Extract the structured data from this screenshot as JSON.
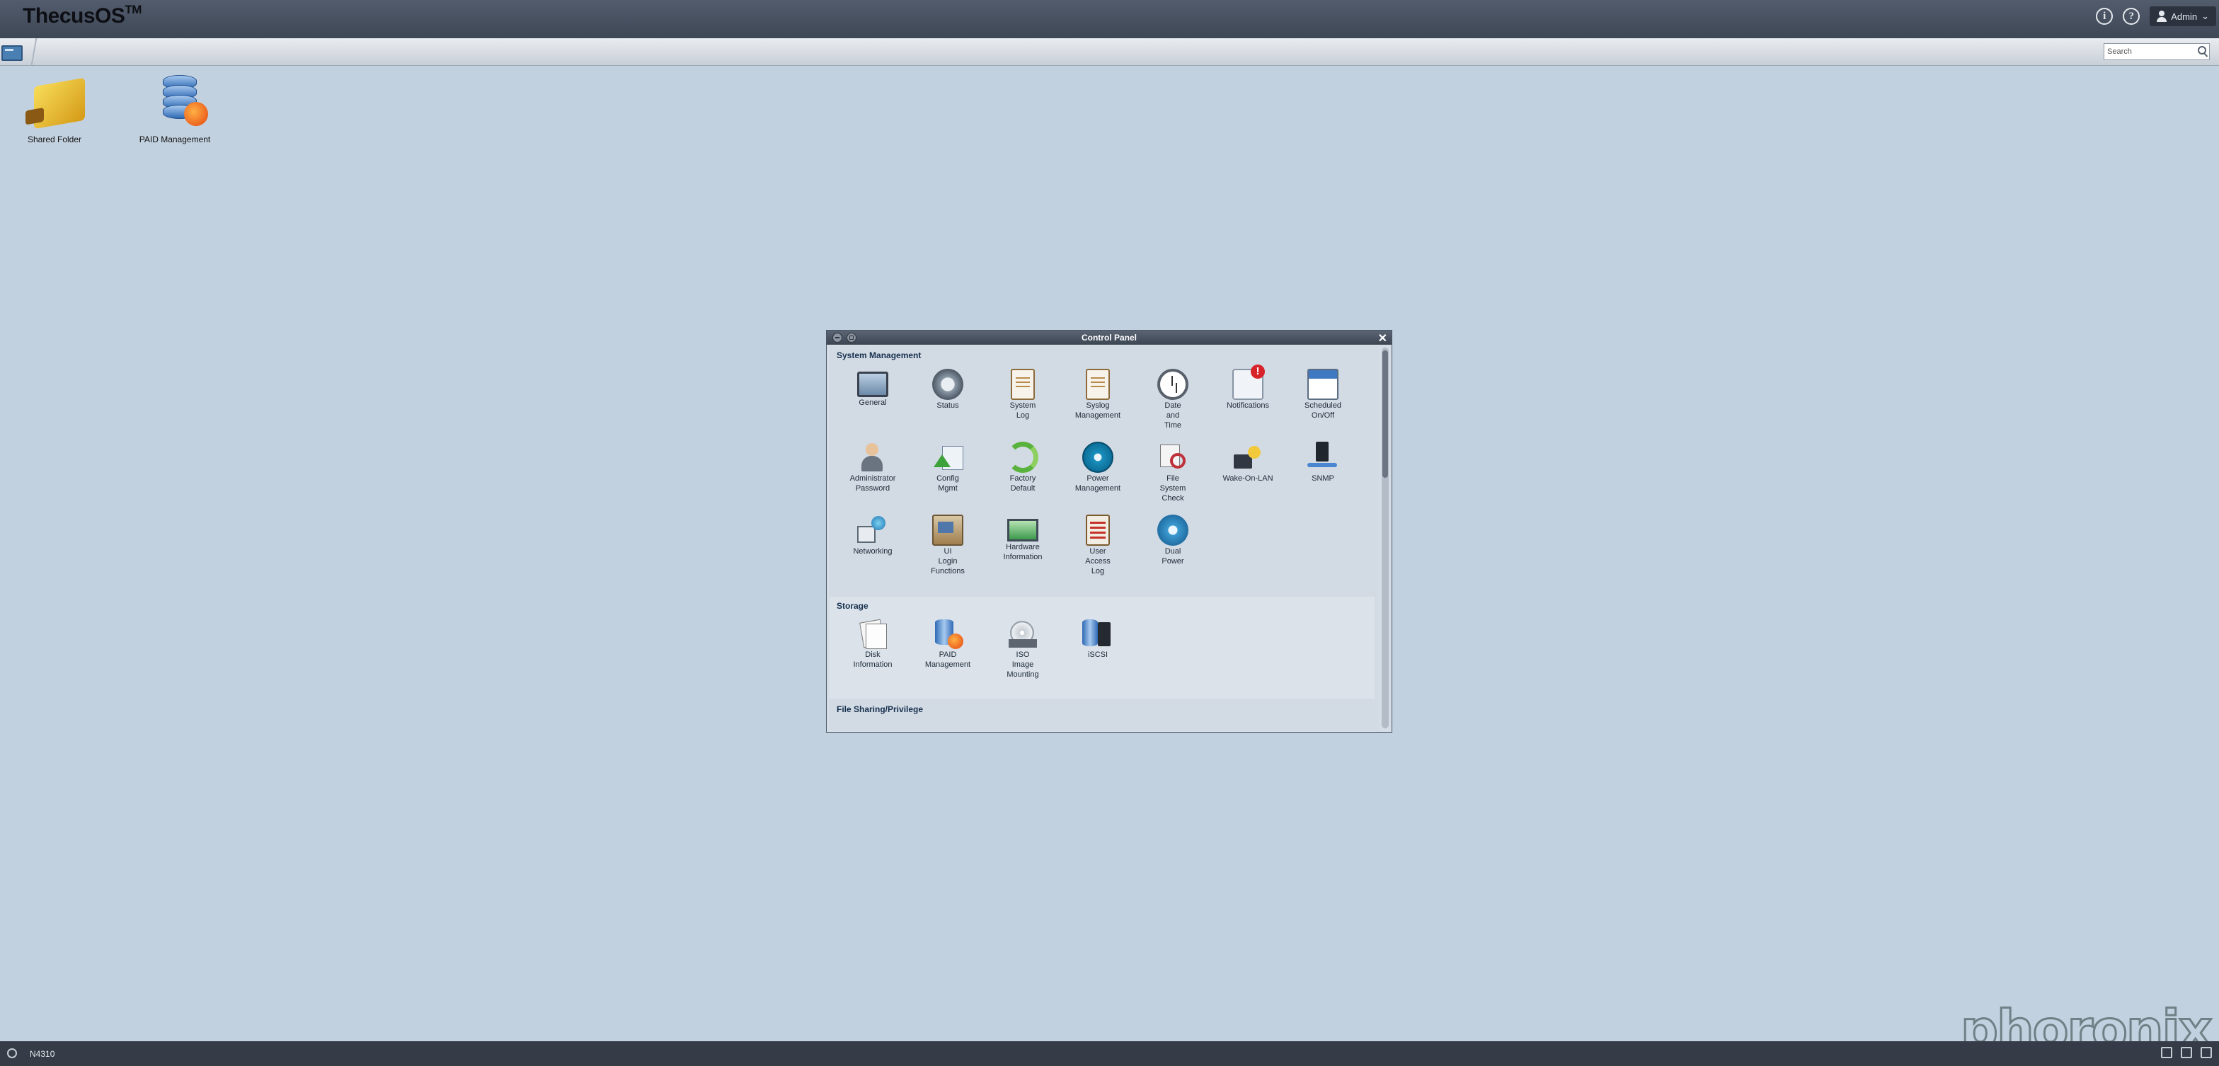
{
  "topbar": {
    "brand": "ThecusOS",
    "brand_sup": "TM",
    "user": "Admin"
  },
  "search": {
    "placeholder": "Search"
  },
  "desktop": {
    "icons": [
      {
        "label": "Shared Folder"
      },
      {
        "label": "PAID Management"
      }
    ]
  },
  "control_panel": {
    "title": "Control Panel",
    "sections": [
      {
        "title": "System Management",
        "items": [
          {
            "label": "General",
            "icon": "general-icon"
          },
          {
            "label": "Status",
            "icon": "status-icon"
          },
          {
            "label": "System\nLog",
            "icon": "system-log-icon"
          },
          {
            "label": "Syslog\nManagement",
            "icon": "syslog-icon"
          },
          {
            "label": "Date\nand\nTime",
            "icon": "clock-icon"
          },
          {
            "label": "Notifications",
            "icon": "notifications-icon"
          },
          {
            "label": "Scheduled\nOn/Off",
            "icon": "schedule-icon"
          },
          {
            "label": "Administrator\nPassword",
            "icon": "admin-icon"
          },
          {
            "label": "Config\nMgmt",
            "icon": "config-icon"
          },
          {
            "label": "Factory\nDefault",
            "icon": "recycle-icon"
          },
          {
            "label": "Power\nManagement",
            "icon": "power-icon"
          },
          {
            "label": "File\nSystem\nCheck",
            "icon": "stethoscope-icon"
          },
          {
            "label": "Wake-On-LAN",
            "icon": "wake-on-lan-icon"
          },
          {
            "label": "SNMP",
            "icon": "snmp-icon"
          },
          {
            "label": "Networking",
            "icon": "network-icon"
          },
          {
            "label": "UI\nLogin\nFunctions",
            "icon": "login-icon"
          },
          {
            "label": "Hardware\nInformation",
            "icon": "hardware-icon"
          },
          {
            "label": "User\nAccess\nLog",
            "icon": "clipboard-icon"
          },
          {
            "label": "Dual\nPower",
            "icon": "dual-power-icon"
          }
        ]
      },
      {
        "title": "Storage",
        "items": [
          {
            "label": "Disk\nInformation",
            "icon": "disk-icon"
          },
          {
            "label": "PAID\nManagement",
            "icon": "raid-icon"
          },
          {
            "label": "ISO\nImage\nMounting",
            "icon": "iso-icon"
          },
          {
            "label": "iSCSI",
            "icon": "iscsi-icon"
          }
        ]
      },
      {
        "title": "File Sharing/Privilege",
        "items": []
      }
    ]
  },
  "taskbar": {
    "host": "N4310"
  },
  "watermark": "phoronix"
}
